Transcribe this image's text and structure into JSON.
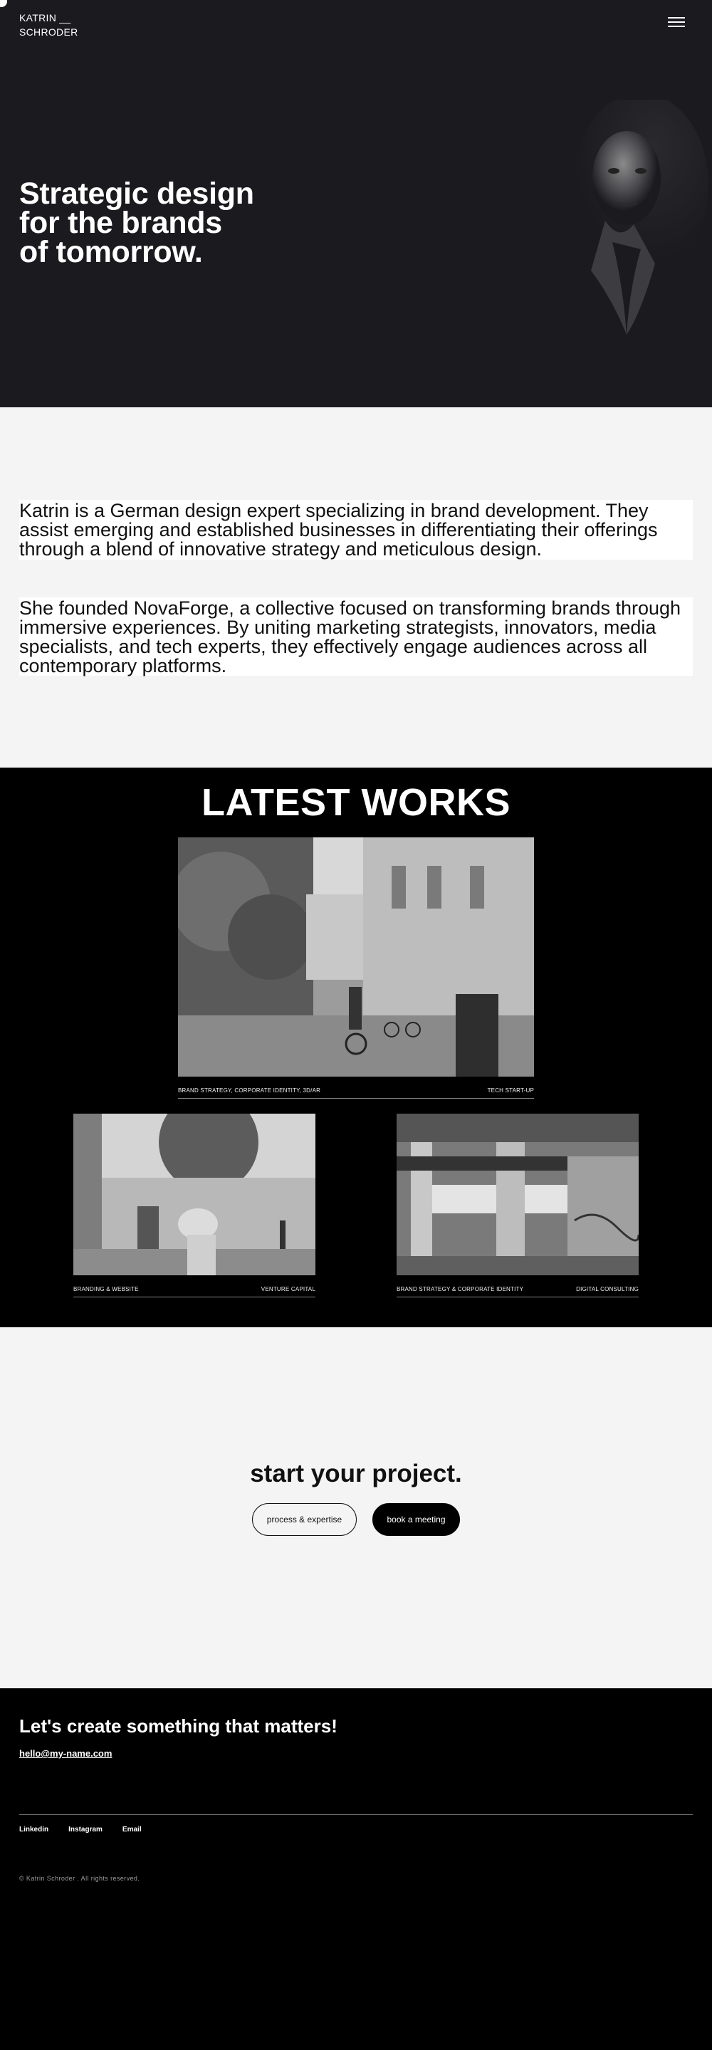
{
  "header": {
    "brand_line1": "KATRIN __",
    "brand_line2": "SCHRODER",
    "menu_icon": "hamburger-menu-icon"
  },
  "hero": {
    "title_line1": "Strategic design",
    "title_line2": "for the brands",
    "title_line3": "of tomorrow."
  },
  "intro": {
    "paragraph1": "Katrin is a German design expert specializing in brand development. They assist emerging and established businesses in differentiating their offerings through a blend of innovative strategy and meticulous design.",
    "paragraph2": "She founded NovaForge, a collective focused on transforming brands through immersive experiences. By uniting marketing strategists, innovators, media specialists, and tech experts, they effectively engage audiences across all contemporary platforms."
  },
  "works": {
    "title": "LATEST WORKS",
    "items": [
      {
        "services": "BRAND STRATEGY, CORPORATE IDENTITY, 3D/AR",
        "category": "TECH START-UP"
      },
      {
        "services": "BRANDING & WEBSITE",
        "category": "VENTURE CAPITAL"
      },
      {
        "services": "BRAND STRATEGY & CORPORATE IDENTITY",
        "category": "DIGITAL CONSULTING"
      }
    ]
  },
  "cta": {
    "title": "start your project.",
    "button_outline": "process & expertise",
    "button_solid": "book a meeting"
  },
  "footer": {
    "title": "Let's create something that matters!",
    "email": "hello@my-name.com",
    "social": [
      "Linkedin",
      "Instagram",
      "Email"
    ],
    "copyright": "© Katrin Schroder . All rights reserved."
  }
}
